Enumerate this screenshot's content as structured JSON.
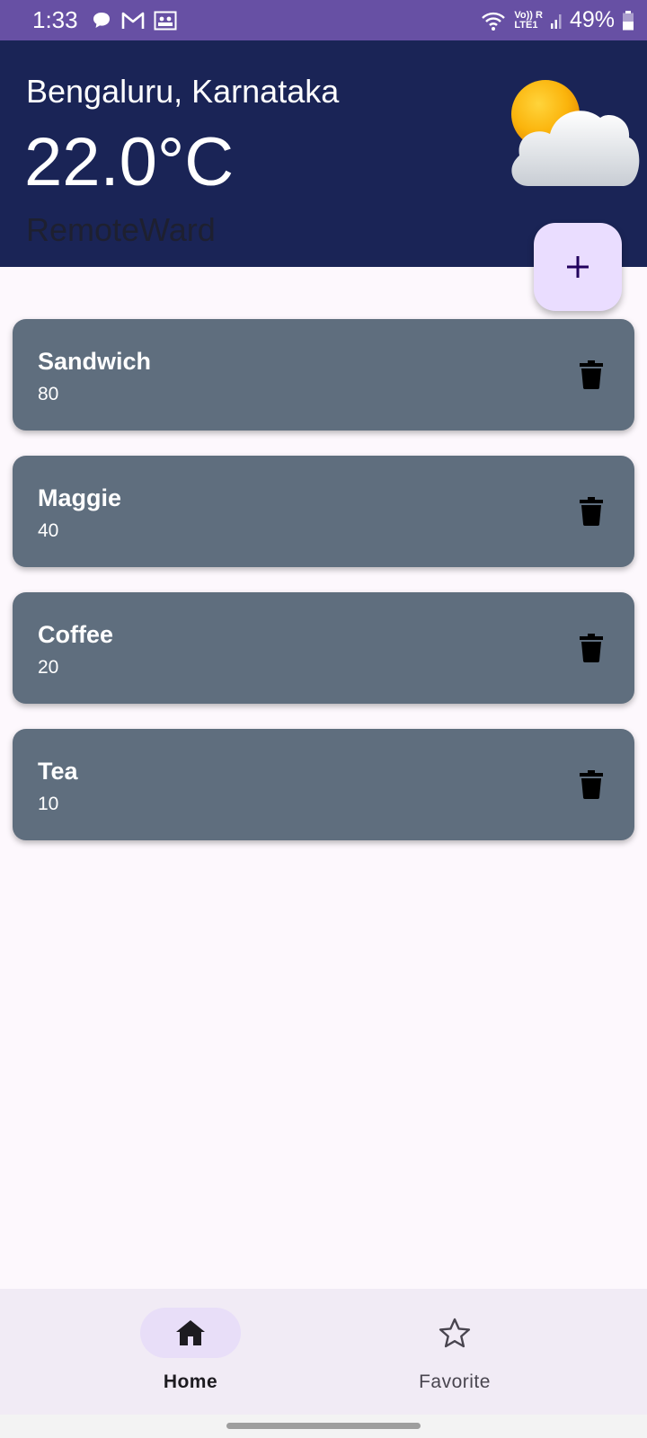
{
  "status_bar": {
    "time": "1:33",
    "battery": "49%",
    "network_top": "Vo)) R",
    "network_bottom": "LTE1"
  },
  "weather": {
    "city": "Bengaluru, Karnataka",
    "temperature": "22.0°C",
    "subtitle": "RemoteWard",
    "icon": "partly-cloudy-icon"
  },
  "fab": {
    "icon": "plus-icon"
  },
  "items": [
    {
      "name": "Sandwich",
      "price": "80"
    },
    {
      "name": "Maggie",
      "price": "40"
    },
    {
      "name": "Coffee",
      "price": "20"
    },
    {
      "name": "Tea",
      "price": "10"
    }
  ],
  "nav": {
    "home_label": "Home",
    "favorite_label": "Favorite"
  },
  "colors": {
    "status_bar": "#6750a4",
    "header": "#1a2456",
    "card": "#5f6e7e",
    "fab": "#eaddff",
    "background": "#fdf8fd",
    "nav_bar": "#f1ebf5",
    "nav_active": "#e8def8"
  }
}
